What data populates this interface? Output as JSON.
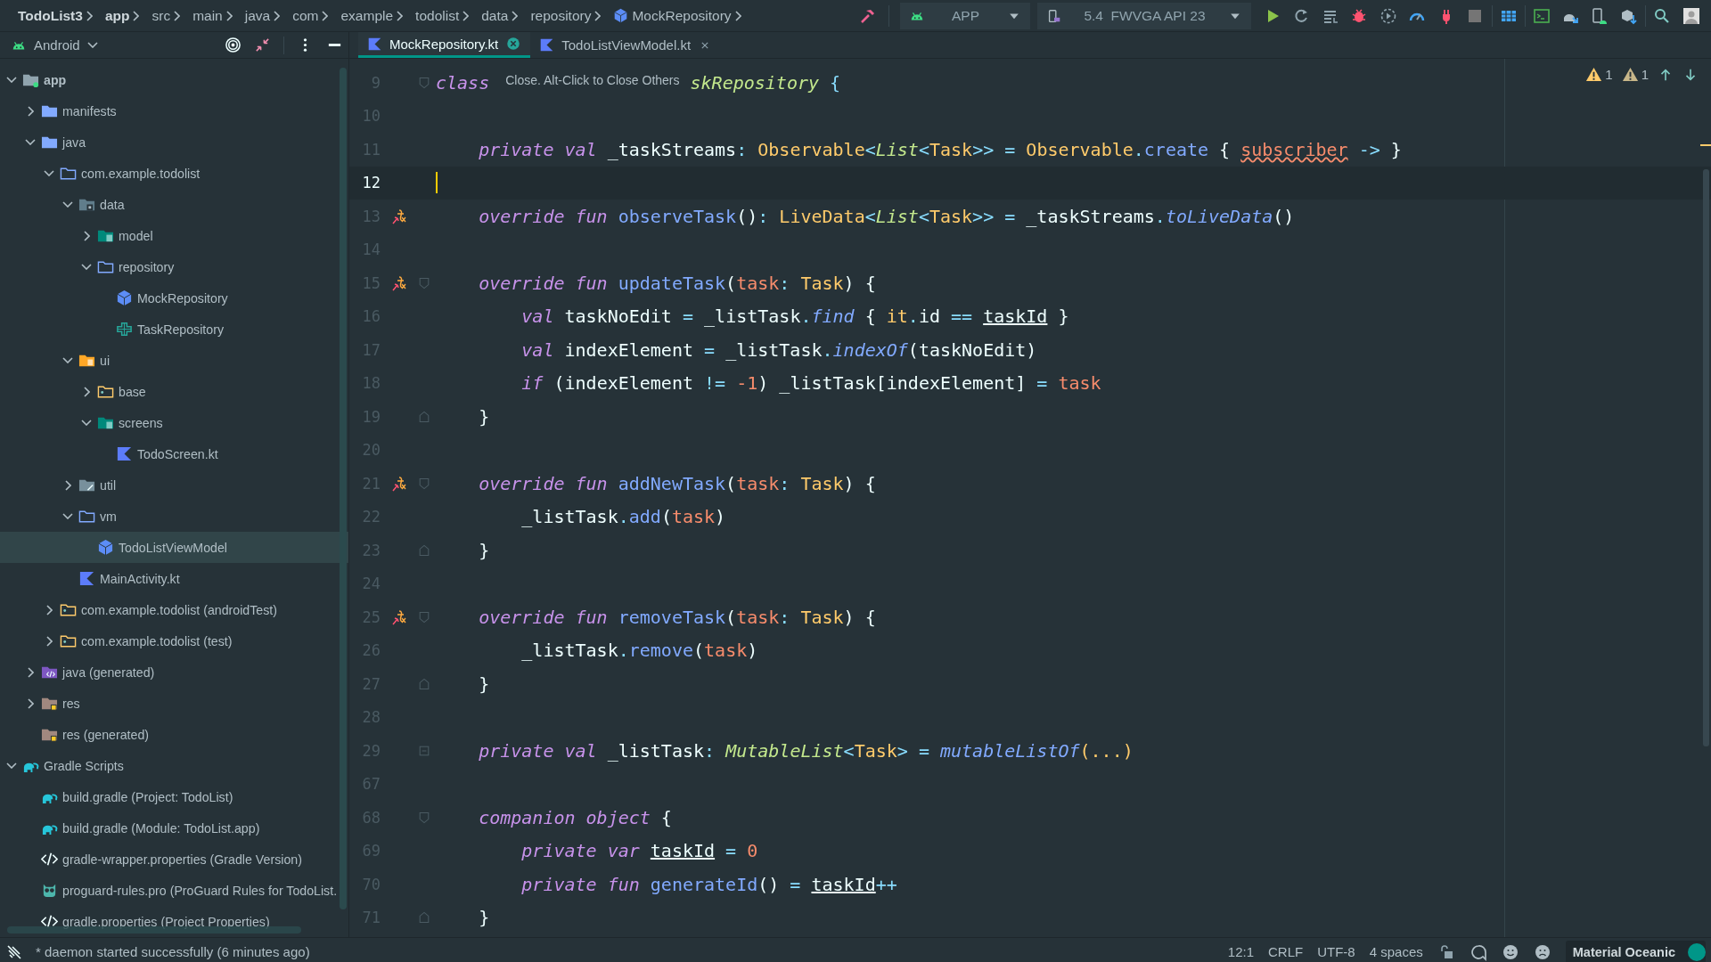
{
  "breadcrumbs": [
    {
      "label": "TodoList3",
      "bold": true,
      "kind": "text"
    },
    {
      "label": "app",
      "bold": true,
      "kind": "text"
    },
    {
      "label": "src",
      "bold": false,
      "kind": "text"
    },
    {
      "label": "main",
      "bold": false,
      "kind": "text"
    },
    {
      "label": "java",
      "bold": false,
      "kind": "text"
    },
    {
      "label": "com",
      "bold": false,
      "kind": "text"
    },
    {
      "label": "example",
      "bold": false,
      "kind": "text"
    },
    {
      "label": "todolist",
      "bold": false,
      "kind": "text"
    },
    {
      "label": "data",
      "bold": false,
      "kind": "text"
    },
    {
      "label": "repository",
      "bold": false,
      "kind": "text"
    },
    {
      "label": "MockRepository",
      "bold": false,
      "kind": "class"
    }
  ],
  "toolbar": {
    "run_config": "APP",
    "device": "5.4  FWVGA API 23"
  },
  "project_view": {
    "label": "Android"
  },
  "tabs": [
    {
      "label": "MockRepository.kt",
      "selected": true
    },
    {
      "label": "TodoListViewModel.kt",
      "selected": false
    }
  ],
  "tree": [
    {
      "label": "app",
      "kind": "module",
      "expanded": true,
      "selected": false,
      "children": [
        {
          "label": "manifests",
          "kind": "folder",
          "expanded": false,
          "selected": false
        },
        {
          "label": "java",
          "kind": "folder",
          "expanded": true,
          "selected": false,
          "children": [
            {
              "label": "com.example.todolist",
              "kind": "package",
              "expanded": true,
              "selected": false,
              "children": [
                {
                  "label": "data",
                  "kind": "pkg_data",
                  "expanded": true,
                  "selected": false,
                  "children": [
                    {
                      "label": "model",
                      "kind": "pkg_model",
                      "expanded": false,
                      "selected": false
                    },
                    {
                      "label": "repository",
                      "kind": "package",
                      "expanded": true,
                      "selected": false,
                      "children": [
                        {
                          "label": "MockRepository",
                          "kind": "class",
                          "selected": false
                        },
                        {
                          "label": "TaskRepository",
                          "kind": "interface",
                          "selected": false
                        }
                      ]
                    }
                  ]
                },
                {
                  "label": "ui",
                  "kind": "pkg_ui",
                  "expanded": true,
                  "selected": false,
                  "children": [
                    {
                      "label": "base",
                      "kind": "pkg_test",
                      "expanded": false,
                      "selected": false
                    },
                    {
                      "label": "screens",
                      "kind": "pkg_model",
                      "expanded": true,
                      "selected": false,
                      "children": [
                        {
                          "label": "TodoScreen.kt",
                          "kind": "kotlin",
                          "selected": false
                        }
                      ]
                    }
                  ]
                },
                {
                  "label": "util",
                  "kind": "pkg_grey",
                  "expanded": false,
                  "selected": false
                },
                {
                  "label": "vm",
                  "kind": "package",
                  "expanded": true,
                  "selected": false,
                  "children": [
                    {
                      "label": "TodoListViewModel",
                      "kind": "class",
                      "selected": true
                    }
                  ]
                },
                {
                  "label": "MainActivity.kt",
                  "kind": "kotlin",
                  "selected": false
                }
              ]
            },
            {
              "label": "com.example.todolist (androidTest)",
              "kind": "pkg_test",
              "expanded": false,
              "selected": false
            },
            {
              "label": "com.example.todolist (test)",
              "kind": "pkg_test",
              "expanded": false,
              "selected": false
            }
          ]
        },
        {
          "label": "java (generated)",
          "kind": "folder_gen",
          "expanded": false,
          "selected": false
        },
        {
          "label": "res",
          "kind": "res",
          "expanded": false,
          "selected": false
        },
        {
          "label": "res (generated)",
          "kind": "res",
          "selected": false
        }
      ]
    },
    {
      "label": "Gradle Scripts",
      "kind": "gradle",
      "expanded": true,
      "selected": false,
      "children": [
        {
          "label": "build.gradle (Project: TodoList)",
          "kind": "gradle",
          "selected": false
        },
        {
          "label": "build.gradle (Module: TodoList.app)",
          "kind": "gradle",
          "selected": false
        },
        {
          "label": "gradle-wrapper.properties (Gradle Version)",
          "kind": "props",
          "selected": false
        },
        {
          "label": "proguard-rules.pro (ProGuard Rules for TodoList.",
          "kind": "proguard",
          "selected": false
        },
        {
          "label": "gradle.properties (Project Properties)",
          "kind": "props",
          "selected": false
        }
      ]
    }
  ],
  "editor": {
    "warnings": [
      {
        "count": "1",
        "kind": "warning"
      },
      {
        "count": "1",
        "kind": "weak_warning"
      }
    ],
    "lines": [
      {
        "number": "9",
        "current": false,
        "override": false,
        "fold": {
          "kind": "start"
        },
        "tokens": [
          {
            "kind": "kw",
            "text": "class"
          },
          {
            "kind": "tooltip",
            "text": "Close. Alt-Click to Close Others"
          },
          {
            "kind": "cls",
            "text": "skRepository"
          },
          {
            "kind": "punct",
            "text": " {"
          }
        ]
      },
      {
        "number": "10",
        "current": false,
        "override": false
      },
      {
        "number": "11",
        "current": false,
        "override": false,
        "tokens": [
          {
            "kind": "kw",
            "text": "    private val"
          },
          {
            "kind": "plain",
            "text": " _taskStreams"
          },
          {
            "kind": "punct",
            "text": ": "
          },
          {
            "kind": "type",
            "text": "Observable"
          },
          {
            "kind": "punct",
            "text": "<"
          },
          {
            "kind": "gen",
            "text": "List"
          },
          {
            "kind": "punct",
            "text": "<"
          },
          {
            "kind": "type",
            "text": "Task"
          },
          {
            "kind": "punct",
            "text": ">> = "
          },
          {
            "kind": "type",
            "text": "Observable"
          },
          {
            "kind": "punct",
            "text": "."
          },
          {
            "kind": "fn",
            "text": "create"
          },
          {
            "kind": "plain",
            "text": " { "
          },
          {
            "kind": "warn",
            "text": "subscriber"
          },
          {
            "kind": "punct",
            "text": " -> "
          },
          {
            "kind": "plain",
            "text": "}"
          }
        ]
      },
      {
        "number": "12",
        "current": true,
        "override": false
      },
      {
        "number": "13",
        "current": false,
        "override": true,
        "tokens": [
          {
            "kind": "kw",
            "text": "    override fun"
          },
          {
            "kind": "fn",
            "text": " observeTask"
          },
          {
            "kind": "plain",
            "text": "()"
          },
          {
            "kind": "punct",
            "text": ": "
          },
          {
            "kind": "type",
            "text": "LiveData"
          },
          {
            "kind": "punct",
            "text": "<"
          },
          {
            "kind": "gen",
            "text": "List"
          },
          {
            "kind": "punct",
            "text": "<"
          },
          {
            "kind": "type",
            "text": "Task"
          },
          {
            "kind": "punct",
            "text": ">> = "
          },
          {
            "kind": "plain",
            "text": "_taskStreams"
          },
          {
            "kind": "punct",
            "text": "."
          },
          {
            "kind": "ext",
            "text": "toLiveData"
          },
          {
            "kind": "plain",
            "text": "()"
          }
        ]
      },
      {
        "number": "14",
        "current": false,
        "override": false
      },
      {
        "number": "15",
        "current": false,
        "override": true,
        "fold": {
          "kind": "start"
        },
        "tokens": [
          {
            "kind": "kw",
            "text": "    override fun"
          },
          {
            "kind": "fn",
            "text": " updateTask"
          },
          {
            "kind": "plain",
            "text": "("
          },
          {
            "kind": "param",
            "text": "task"
          },
          {
            "kind": "punct",
            "text": ": "
          },
          {
            "kind": "type",
            "text": "Task"
          },
          {
            "kind": "plain",
            "text": ") {"
          }
        ]
      },
      {
        "number": "16",
        "current": false,
        "override": false,
        "tokens": [
          {
            "kind": "kw",
            "text": "        val"
          },
          {
            "kind": "plain",
            "text": " taskNoEdit "
          },
          {
            "kind": "punct",
            "text": "= "
          },
          {
            "kind": "plain",
            "text": "_listTask"
          },
          {
            "kind": "punct",
            "text": "."
          },
          {
            "kind": "ext",
            "text": "find"
          },
          {
            "kind": "plain",
            "text": " { "
          },
          {
            "kind": "it",
            "text": "it"
          },
          {
            "kind": "punct",
            "text": "."
          },
          {
            "kind": "plain",
            "text": "id "
          },
          {
            "kind": "punct",
            "text": "== "
          },
          {
            "kind": "ul",
            "text": "taskId"
          },
          {
            "kind": "plain",
            "text": " }"
          }
        ]
      },
      {
        "number": "17",
        "current": false,
        "override": false,
        "tokens": [
          {
            "kind": "kw",
            "text": "        val"
          },
          {
            "kind": "plain",
            "text": " indexElement "
          },
          {
            "kind": "punct",
            "text": "= "
          },
          {
            "kind": "plain",
            "text": "_listTask"
          },
          {
            "kind": "punct",
            "text": "."
          },
          {
            "kind": "ext",
            "text": "indexOf"
          },
          {
            "kind": "plain",
            "text": "(taskNoEdit)"
          }
        ]
      },
      {
        "number": "18",
        "current": false,
        "override": false,
        "tokens": [
          {
            "kind": "kw",
            "text": "        if"
          },
          {
            "kind": "plain",
            "text": " (indexElement "
          },
          {
            "kind": "punct",
            "text": "!= "
          },
          {
            "kind": "num",
            "text": "-1"
          },
          {
            "kind": "plain",
            "text": ") _listTask[indexElement] "
          },
          {
            "kind": "punct",
            "text": "= "
          },
          {
            "kind": "param",
            "text": "task"
          }
        ]
      },
      {
        "number": "19",
        "current": false,
        "override": false,
        "fold": {
          "kind": "end"
        },
        "tokens": [
          {
            "kind": "plain",
            "text": "    }"
          }
        ]
      },
      {
        "number": "20",
        "current": false,
        "override": false
      },
      {
        "number": "21",
        "current": false,
        "override": true,
        "fold": {
          "kind": "start"
        },
        "tokens": [
          {
            "kind": "kw",
            "text": "    override fun"
          },
          {
            "kind": "fn",
            "text": " addNewTask"
          },
          {
            "kind": "plain",
            "text": "("
          },
          {
            "kind": "param",
            "text": "task"
          },
          {
            "kind": "punct",
            "text": ": "
          },
          {
            "kind": "type",
            "text": "Task"
          },
          {
            "kind": "plain",
            "text": ") {"
          }
        ]
      },
      {
        "number": "22",
        "current": false,
        "override": false,
        "tokens": [
          {
            "kind": "plain",
            "text": "        _listTask"
          },
          {
            "kind": "punct",
            "text": "."
          },
          {
            "kind": "fn",
            "text": "add"
          },
          {
            "kind": "plain",
            "text": "("
          },
          {
            "kind": "param",
            "text": "task"
          },
          {
            "kind": "plain",
            "text": ")"
          }
        ]
      },
      {
        "number": "23",
        "current": false,
        "override": false,
        "fold": {
          "kind": "end"
        },
        "tokens": [
          {
            "kind": "plain",
            "text": "    }"
          }
        ]
      },
      {
        "number": "24",
        "current": false,
        "override": false
      },
      {
        "number": "25",
        "current": false,
        "override": true,
        "fold": {
          "kind": "start"
        },
        "tokens": [
          {
            "kind": "kw",
            "text": "    override fun"
          },
          {
            "kind": "fn",
            "text": " removeTask"
          },
          {
            "kind": "plain",
            "text": "("
          },
          {
            "kind": "param",
            "text": "task"
          },
          {
            "kind": "punct",
            "text": ": "
          },
          {
            "kind": "type",
            "text": "Task"
          },
          {
            "kind": "plain",
            "text": ") {"
          }
        ]
      },
      {
        "number": "26",
        "current": false,
        "override": false,
        "tokens": [
          {
            "kind": "plain",
            "text": "        _listTask"
          },
          {
            "kind": "punct",
            "text": "."
          },
          {
            "kind": "fn",
            "text": "remove"
          },
          {
            "kind": "plain",
            "text": "("
          },
          {
            "kind": "param",
            "text": "task"
          },
          {
            "kind": "plain",
            "text": ")"
          }
        ]
      },
      {
        "number": "27",
        "current": false,
        "override": false,
        "fold": {
          "kind": "end"
        },
        "tokens": [
          {
            "kind": "plain",
            "text": "    }"
          }
        ]
      },
      {
        "number": "28",
        "current": false,
        "override": false
      },
      {
        "number": "29",
        "current": false,
        "override": false,
        "fold": {
          "kind": "folded"
        },
        "tokens": [
          {
            "kind": "kw",
            "text": "    private val"
          },
          {
            "kind": "plain",
            "text": " _listTask"
          },
          {
            "kind": "punct",
            "text": ": "
          },
          {
            "kind": "gen",
            "text": "MutableList"
          },
          {
            "kind": "punct",
            "text": "<"
          },
          {
            "kind": "type",
            "text": "Task"
          },
          {
            "kind": "punct",
            "text": "> = "
          },
          {
            "kind": "ext",
            "text": "mutableListOf"
          },
          {
            "kind": "folded",
            "text": "(...)"
          }
        ]
      },
      {
        "number": "67",
        "current": false,
        "override": false
      },
      {
        "number": "68",
        "current": false,
        "override": false,
        "fold": {
          "kind": "start"
        },
        "tokens": [
          {
            "kind": "kw",
            "text": "    companion object"
          },
          {
            "kind": "plain",
            "text": " {"
          }
        ]
      },
      {
        "number": "69",
        "current": false,
        "override": false,
        "tokens": [
          {
            "kind": "kw",
            "text": "        private var "
          },
          {
            "kind": "ul",
            "text": "taskId"
          },
          {
            "kind": "punct",
            "text": " = "
          },
          {
            "kind": "num",
            "text": "0"
          }
        ]
      },
      {
        "number": "70",
        "current": false,
        "override": false,
        "tokens": [
          {
            "kind": "kw",
            "text": "        private fun"
          },
          {
            "kind": "fn",
            "text": " generateId"
          },
          {
            "kind": "plain",
            "text": "() "
          },
          {
            "kind": "punct",
            "text": "= "
          },
          {
            "kind": "ul",
            "text": "taskId"
          },
          {
            "kind": "punct",
            "text": "++"
          }
        ]
      },
      {
        "number": "71",
        "current": false,
        "override": false,
        "fold": {
          "kind": "end"
        },
        "tokens": [
          {
            "kind": "plain",
            "text": "    }"
          }
        ]
      }
    ]
  },
  "status": {
    "message": "* daemon started successfully (6 minutes ago)",
    "position": "12:1",
    "line_ending": "CRLF",
    "encoding": "UTF-8",
    "indent": "4 spaces",
    "theme": "Material Oceanic"
  }
}
